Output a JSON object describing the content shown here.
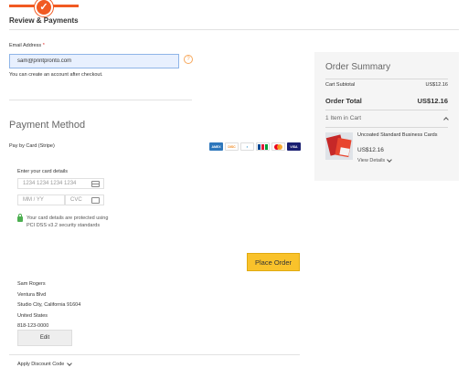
{
  "progress": {
    "step_title": "Review & Payments",
    "accent_color": "#f15a22",
    "step_icon": "checkmark-icon"
  },
  "email": {
    "label": "Email Address",
    "required_mark": "*",
    "value": "sam@printpronto.com",
    "note": "You can create an account after checkout.",
    "help_icon": "question-mark-icon"
  },
  "payment": {
    "title": "Payment Method",
    "method_label": "Pay by Card (Stripe)",
    "card_brands": [
      "American Express",
      "Discover",
      "Diners Club",
      "JCB",
      "Mastercard",
      "Visa"
    ],
    "card_brand_labels": {
      "amex": "AMEX",
      "discover": "DISC",
      "diners": "◐",
      "visa": "VISA"
    },
    "enter_details_label": "Enter your card details",
    "card_number_placeholder": "1234 1234 1234 1234",
    "expiry_placeholder": "MM / YY",
    "cvc_placeholder": "CVC",
    "secure_note": "Your card details are protected using PCI DSS v3.2 security standards",
    "place_order_label": "Place Order",
    "place_order_color": "#f9c22b"
  },
  "billing_address": {
    "lines": [
      "Sam Rogers",
      "Ventura Blvd",
      "Studio City, California 91604",
      "United States",
      "818-123-0000"
    ],
    "edit_label": "Edit"
  },
  "discount": {
    "label": "Apply Discount Code"
  },
  "summary": {
    "title": "Order Summary",
    "subtotal_label": "Cart Subtotal",
    "subtotal_value": "US$12.16",
    "total_label": "Order Total",
    "total_value": "US$12.16",
    "items_label": "1 Item in Cart",
    "item": {
      "name": "Uncoated Standard Business Cards",
      "price": "US$12.16",
      "details_label": "View Details"
    }
  }
}
